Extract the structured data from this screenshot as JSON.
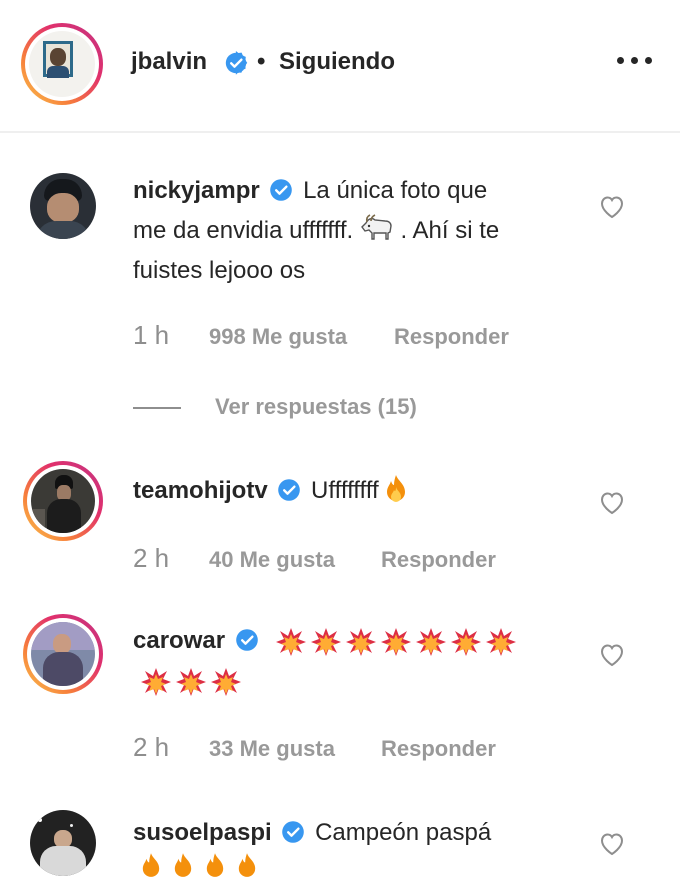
{
  "post": {
    "author": "jbalvin",
    "separator": "•",
    "follow_state": "Siguiendo"
  },
  "comments": [
    {
      "username": "nickyjampr",
      "lines": [
        "La única foto que",
        "me da envidia ufffffff.",
        ". Ahí si te",
        "fuistes lejooo os"
      ],
      "time": "1 h",
      "likes": "998 Me gusta",
      "reply": "Responder",
      "view_replies": "Ver respuestas (15)"
    },
    {
      "username": "teamohijotv",
      "text": "Uffffffff",
      "time": "2 h",
      "likes": "40 Me gusta",
      "reply": "Responder"
    },
    {
      "username": "carowar",
      "emoji": "collision-emoji",
      "emoji_count_line1": 7,
      "emoji_count_line2": 3,
      "time": "2 h",
      "likes": "33 Me gusta",
      "reply": "Responder"
    },
    {
      "username": "susoelpaspi",
      "text": "Campeón paspá"
    }
  ],
  "colors": {
    "verified_blue": "#3897f0",
    "meta_gray": "#8e8e8e",
    "story_ring": "#e1306c"
  }
}
